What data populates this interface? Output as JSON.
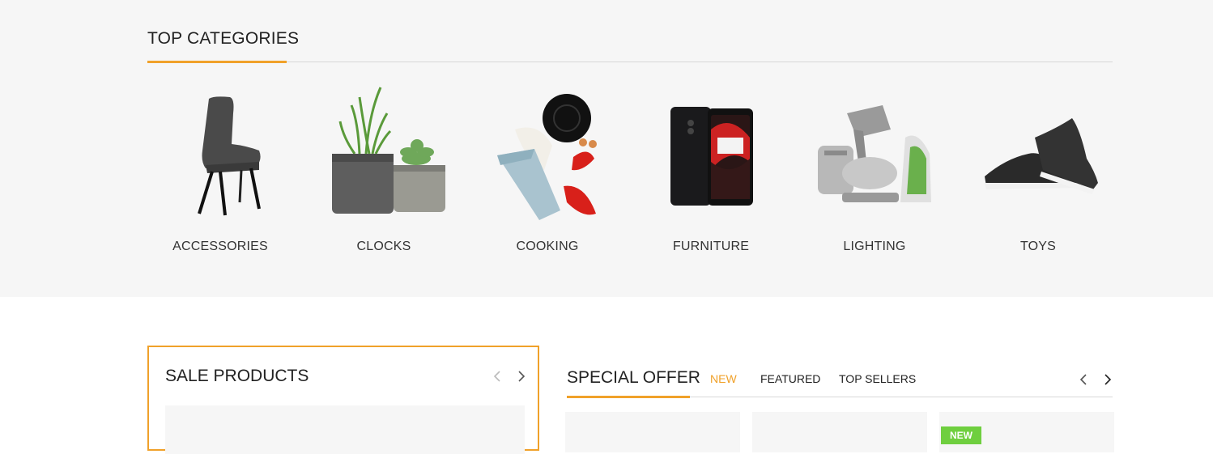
{
  "top_categories": {
    "title": "TOP CATEGORIES",
    "accent_color": "#f0a12a",
    "items": [
      {
        "label": "ACCESSORIES",
        "icon": "chair-icon"
      },
      {
        "label": "CLOCKS",
        "icon": "potted-plants-icon"
      },
      {
        "label": "COOKING",
        "icon": "fashion-accessories-icon"
      },
      {
        "label": "FURNITURE",
        "icon": "smartphone-icon"
      },
      {
        "label": "LIGHTING",
        "icon": "kitchen-appliances-icon"
      },
      {
        "label": "TOYS",
        "icon": "sneakers-icon"
      }
    ]
  },
  "sale_products": {
    "title": "SALE PRODUCTS",
    "prev_icon": "chevron-left-icon",
    "next_icon": "chevron-right-icon"
  },
  "special_offer": {
    "title": "SPECIAL OFFER",
    "tabs": [
      {
        "label": "NEW",
        "active": true
      },
      {
        "label": "FEATURED",
        "active": false
      },
      {
        "label": "TOP SELLERS",
        "active": false
      }
    ],
    "badge": "NEW",
    "badge_color": "#6fcf3f"
  },
  "colors": {
    "band_bg": "#f6f6f6",
    "accent": "#f0a12a"
  }
}
